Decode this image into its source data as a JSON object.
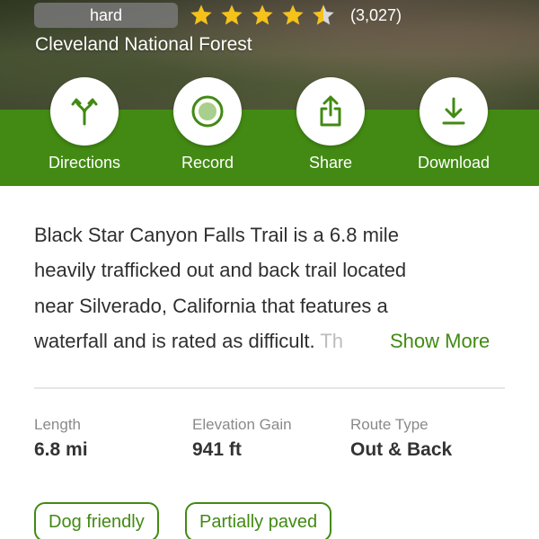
{
  "header": {
    "difficulty": "hard",
    "rating": 4.5,
    "rating_count": "(3,027)",
    "park_name": "Cleveland National Forest"
  },
  "actions": [
    {
      "label": "Directions",
      "icon": "directions-icon"
    },
    {
      "label": "Record",
      "icon": "record-icon"
    },
    {
      "label": "Share",
      "icon": "share-icon"
    },
    {
      "label": "Download",
      "icon": "download-icon"
    }
  ],
  "description": {
    "lines": [
      "Black Star Canyon Falls Trail is a 6.8 mile",
      "heavily trafficked out and back trail located",
      "near Silverado, California that features a",
      "waterfall and is rated as difficult. "
    ],
    "truncated_fragment": "Th",
    "show_more_label": "Show More"
  },
  "stats": [
    {
      "label": "Length",
      "value": "6.8 mi"
    },
    {
      "label": "Elevation Gain",
      "value": "941 ft"
    },
    {
      "label": "Route Type",
      "value": "Out & Back"
    }
  ],
  "tags": [
    "Dog friendly",
    "Partially paved"
  ],
  "colors": {
    "accent": "#428a13",
    "star": "#f5c21b",
    "text": "#2f2f2f",
    "muted": "#8a8a8a"
  }
}
